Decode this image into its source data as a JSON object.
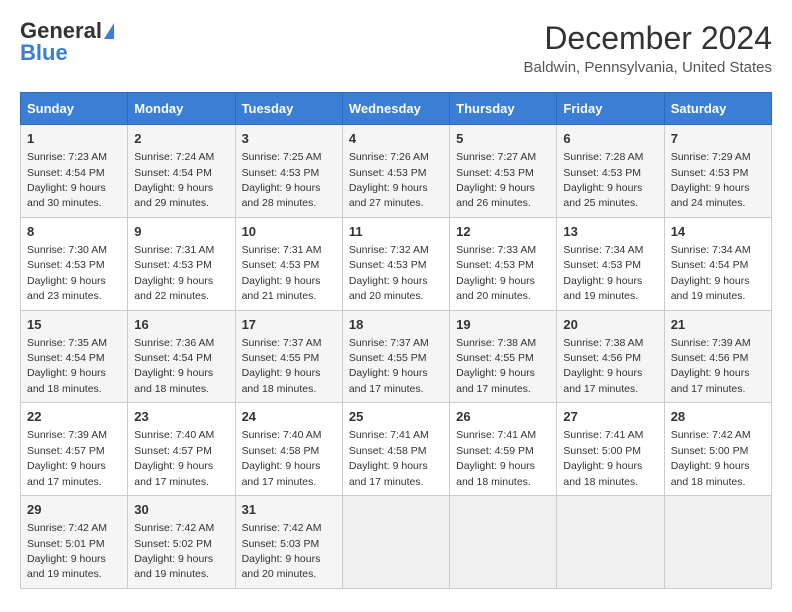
{
  "logo": {
    "general": "General",
    "blue": "Blue"
  },
  "title": {
    "month": "December 2024",
    "location": "Baldwin, Pennsylvania, United States"
  },
  "headers": [
    "Sunday",
    "Monday",
    "Tuesday",
    "Wednesday",
    "Thursday",
    "Friday",
    "Saturday"
  ],
  "weeks": [
    [
      {
        "day": "1",
        "sunrise": "7:23 AM",
        "sunset": "4:54 PM",
        "daylight": "9 hours and 30 minutes."
      },
      {
        "day": "2",
        "sunrise": "7:24 AM",
        "sunset": "4:54 PM",
        "daylight": "9 hours and 29 minutes."
      },
      {
        "day": "3",
        "sunrise": "7:25 AM",
        "sunset": "4:53 PM",
        "daylight": "9 hours and 28 minutes."
      },
      {
        "day": "4",
        "sunrise": "7:26 AM",
        "sunset": "4:53 PM",
        "daylight": "9 hours and 27 minutes."
      },
      {
        "day": "5",
        "sunrise": "7:27 AM",
        "sunset": "4:53 PM",
        "daylight": "9 hours and 26 minutes."
      },
      {
        "day": "6",
        "sunrise": "7:28 AM",
        "sunset": "4:53 PM",
        "daylight": "9 hours and 25 minutes."
      },
      {
        "day": "7",
        "sunrise": "7:29 AM",
        "sunset": "4:53 PM",
        "daylight": "9 hours and 24 minutes."
      }
    ],
    [
      {
        "day": "8",
        "sunrise": "7:30 AM",
        "sunset": "4:53 PM",
        "daylight": "9 hours and 23 minutes."
      },
      {
        "day": "9",
        "sunrise": "7:31 AM",
        "sunset": "4:53 PM",
        "daylight": "9 hours and 22 minutes."
      },
      {
        "day": "10",
        "sunrise": "7:31 AM",
        "sunset": "4:53 PM",
        "daylight": "9 hours and 21 minutes."
      },
      {
        "day": "11",
        "sunrise": "7:32 AM",
        "sunset": "4:53 PM",
        "daylight": "9 hours and 20 minutes."
      },
      {
        "day": "12",
        "sunrise": "7:33 AM",
        "sunset": "4:53 PM",
        "daylight": "9 hours and 20 minutes."
      },
      {
        "day": "13",
        "sunrise": "7:34 AM",
        "sunset": "4:53 PM",
        "daylight": "9 hours and 19 minutes."
      },
      {
        "day": "14",
        "sunrise": "7:34 AM",
        "sunset": "4:54 PM",
        "daylight": "9 hours and 19 minutes."
      }
    ],
    [
      {
        "day": "15",
        "sunrise": "7:35 AM",
        "sunset": "4:54 PM",
        "daylight": "9 hours and 18 minutes."
      },
      {
        "day": "16",
        "sunrise": "7:36 AM",
        "sunset": "4:54 PM",
        "daylight": "9 hours and 18 minutes."
      },
      {
        "day": "17",
        "sunrise": "7:37 AM",
        "sunset": "4:55 PM",
        "daylight": "9 hours and 18 minutes."
      },
      {
        "day": "18",
        "sunrise": "7:37 AM",
        "sunset": "4:55 PM",
        "daylight": "9 hours and 17 minutes."
      },
      {
        "day": "19",
        "sunrise": "7:38 AM",
        "sunset": "4:55 PM",
        "daylight": "9 hours and 17 minutes."
      },
      {
        "day": "20",
        "sunrise": "7:38 AM",
        "sunset": "4:56 PM",
        "daylight": "9 hours and 17 minutes."
      },
      {
        "day": "21",
        "sunrise": "7:39 AM",
        "sunset": "4:56 PM",
        "daylight": "9 hours and 17 minutes."
      }
    ],
    [
      {
        "day": "22",
        "sunrise": "7:39 AM",
        "sunset": "4:57 PM",
        "daylight": "9 hours and 17 minutes."
      },
      {
        "day": "23",
        "sunrise": "7:40 AM",
        "sunset": "4:57 PM",
        "daylight": "9 hours and 17 minutes."
      },
      {
        "day": "24",
        "sunrise": "7:40 AM",
        "sunset": "4:58 PM",
        "daylight": "9 hours and 17 minutes."
      },
      {
        "day": "25",
        "sunrise": "7:41 AM",
        "sunset": "4:58 PM",
        "daylight": "9 hours and 17 minutes."
      },
      {
        "day": "26",
        "sunrise": "7:41 AM",
        "sunset": "4:59 PM",
        "daylight": "9 hours and 18 minutes."
      },
      {
        "day": "27",
        "sunrise": "7:41 AM",
        "sunset": "5:00 PM",
        "daylight": "9 hours and 18 minutes."
      },
      {
        "day": "28",
        "sunrise": "7:42 AM",
        "sunset": "5:00 PM",
        "daylight": "9 hours and 18 minutes."
      }
    ],
    [
      {
        "day": "29",
        "sunrise": "7:42 AM",
        "sunset": "5:01 PM",
        "daylight": "9 hours and 19 minutes."
      },
      {
        "day": "30",
        "sunrise": "7:42 AM",
        "sunset": "5:02 PM",
        "daylight": "9 hours and 19 minutes."
      },
      {
        "day": "31",
        "sunrise": "7:42 AM",
        "sunset": "5:03 PM",
        "daylight": "9 hours and 20 minutes."
      },
      null,
      null,
      null,
      null
    ]
  ],
  "labels": {
    "sunrise": "Sunrise:",
    "sunset": "Sunset:",
    "daylight": "Daylight:"
  }
}
